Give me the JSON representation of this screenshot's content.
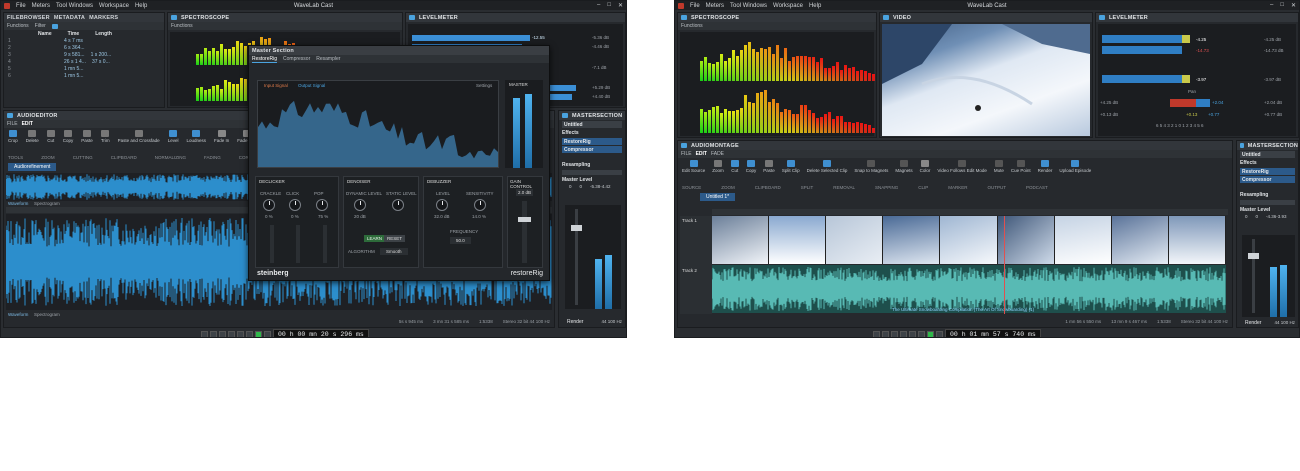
{
  "app_title": "WaveLab Cast",
  "menu": [
    "File",
    "Meters",
    "Tool Windows",
    "Workspace",
    "Help"
  ],
  "window_buttons": [
    "–",
    "□",
    "✕"
  ],
  "left": {
    "file_browser": {
      "tabs": [
        "FILEBROWSER",
        "METADATA",
        "MARKERS"
      ],
      "toolbar": [
        "Functions",
        "Filter"
      ],
      "columns": [
        "Name",
        "Time",
        "Length"
      ],
      "rows": [
        {
          "id": "1",
          "time": "4 s 7 ms"
        },
        {
          "id": "2",
          "time": "6 s 364..."
        },
        {
          "id": "3",
          "time": "9 s 581...",
          "length": "1 s 200..."
        },
        {
          "id": "4",
          "time": "26 s 1 4...",
          "length": "37 s 0..."
        },
        {
          "id": "5",
          "time": "1 mn 5..."
        },
        {
          "id": "6",
          "time": "1 mn 5..."
        }
      ]
    },
    "spectroscope": {
      "title": "SPECTROSCOPE",
      "functions": "Functions"
    },
    "level_meter": {
      "title": "LEVELMETER",
      "values": [
        "-12.55",
        "-5.36 dB",
        "-4.46 dB",
        "-7.1 dB",
        "+5.29 dB",
        "+4.40 dB"
      ]
    },
    "audio_editor": {
      "title": "AUDIOEDITOR",
      "tabs": [
        "FILE",
        "EDIT"
      ],
      "tools": [
        "Crop",
        "Delete",
        "Cut",
        "Copy",
        "Paste",
        "Trim",
        "Paste and Crossfade",
        "Level",
        "Loudness",
        "Fade In",
        "Fade Out",
        "Replace"
      ],
      "groups": [
        "TOOLS",
        "ZOOM",
        "CUTTING",
        "CLIPBOARD",
        "NORMALIZING",
        "FADING",
        "CORRECTION"
      ],
      "file_tab": "Audiorefinement",
      "view_labels": [
        "Waveform",
        "Spectrogram"
      ],
      "status": [
        "5s s 945 ms",
        "3 mn 31 s 585 ms",
        "1:5338",
        "Stereo 32 bit 44 100 Hz"
      ]
    },
    "plugin": {
      "window_title": "Master Section",
      "tabs": [
        "RestoreRig",
        "Compressor",
        "Resampler"
      ],
      "legend": [
        "Input Signal",
        "Output Signal",
        "Settings"
      ],
      "modules": [
        "DECLICKER",
        "DENOISER",
        "DEBUZZER",
        "GAIN CONTROL"
      ],
      "knob_labels": [
        "CRACKLE",
        "CLICK",
        "POP",
        "DYNAMIC LEVEL",
        "STATIC LEVEL",
        "LEVEL",
        "SENSITIVITY",
        "FREQUENCY"
      ],
      "knob_values": [
        "0 %",
        "0 %",
        "75 %",
        "20 dB",
        "",
        "32.0 dB",
        "14.0 %",
        "50.0"
      ],
      "buttons": [
        "LEARN",
        "RESET"
      ],
      "algorithm_label": "ALGORITHM",
      "algorithm_value": "Smooth",
      "master_label": "MASTER",
      "gain_value": "2.0 dB",
      "brand_left": "steinberg",
      "brand_right": "restoreRig"
    },
    "master_section": {
      "title": "MASTERSECTION",
      "preset": "Untitled",
      "effects_label": "Effects",
      "effects": [
        "RestoreRig",
        "Compressor"
      ],
      "resampling": "Resampling",
      "master_level": "Master Level",
      "level_values": [
        "0",
        "0",
        "-5.38-4.42"
      ],
      "render": "Render",
      "sample_rate": "44 100 Hz"
    },
    "timecode": "00 h 00 mn 20 s 296 ms"
  },
  "right": {
    "spectroscope": {
      "title": "SPECTROSCOPE",
      "functions": "Functions"
    },
    "video": {
      "title": "VIDEO"
    },
    "level_meter": {
      "title": "LEVELMETER",
      "values": [
        "-4.25",
        "-4.25 dB",
        "-14.73 dB",
        "-14.73",
        "-3.97",
        "-3.97 dB",
        "+4.25 dB",
        "+2.04",
        "+2.04 dB",
        "+0.13 dB",
        "+0.13",
        "+0.77",
        "+0.77 dB"
      ],
      "pan": "Pan",
      "scale": "6 5 4 3 2 1 0 1 2 3 4 5 6"
    },
    "audio_montage": {
      "title": "AUDIOMONTAGE",
      "tabs": [
        "FILE",
        "EDIT",
        "FADE"
      ],
      "tools": [
        "Edit Source",
        "Zoom",
        "Cut",
        "Copy",
        "Paste",
        "Split Clip",
        "Delete Selected Clip",
        "Snap to Magnets",
        "Magnets",
        "Color",
        "Video Follows Edit Mode",
        "Mute",
        "Cue Point",
        "Render",
        "Upload Episode"
      ],
      "groups": [
        "SOURCE",
        "ZOOM",
        "CLIPBOARD",
        "SPLIT",
        "REMOVAL",
        "SNAPPING",
        "CLIP",
        "MARKER",
        "OUTPUT",
        "PODCAST"
      ],
      "montage_tab": "Untitled 1*",
      "tracks": [
        "Track 1",
        "Track 2"
      ],
      "clip_caption": "The Ultimate Snowboarding Compilation (The Art Of Snowboarding) (1)",
      "status": [
        "1 mn 56 s 550 ms",
        "13 mn 9 s 467 ms",
        "1:5338",
        "Stereo 32 bit 44 100 Hz"
      ]
    },
    "master_section": {
      "title": "MASTERSECTION",
      "preset": "Untitled",
      "effects_label": "Effects",
      "effects": [
        "RestoreRig",
        "Compressor"
      ],
      "resampling": "Resampling",
      "master_level": "Master Level",
      "level_values": [
        "0",
        "0",
        "-4.36-3.93"
      ],
      "render": "Render",
      "sample_rate": "44 100 Hz"
    },
    "timecode": "00 h 01 mn 57 s 740 ms"
  },
  "colors": {
    "accent": "#3a8fd6",
    "wave": "#2e9be0",
    "montage_wave": "#2a8f8a",
    "play": "#2fb84a"
  }
}
